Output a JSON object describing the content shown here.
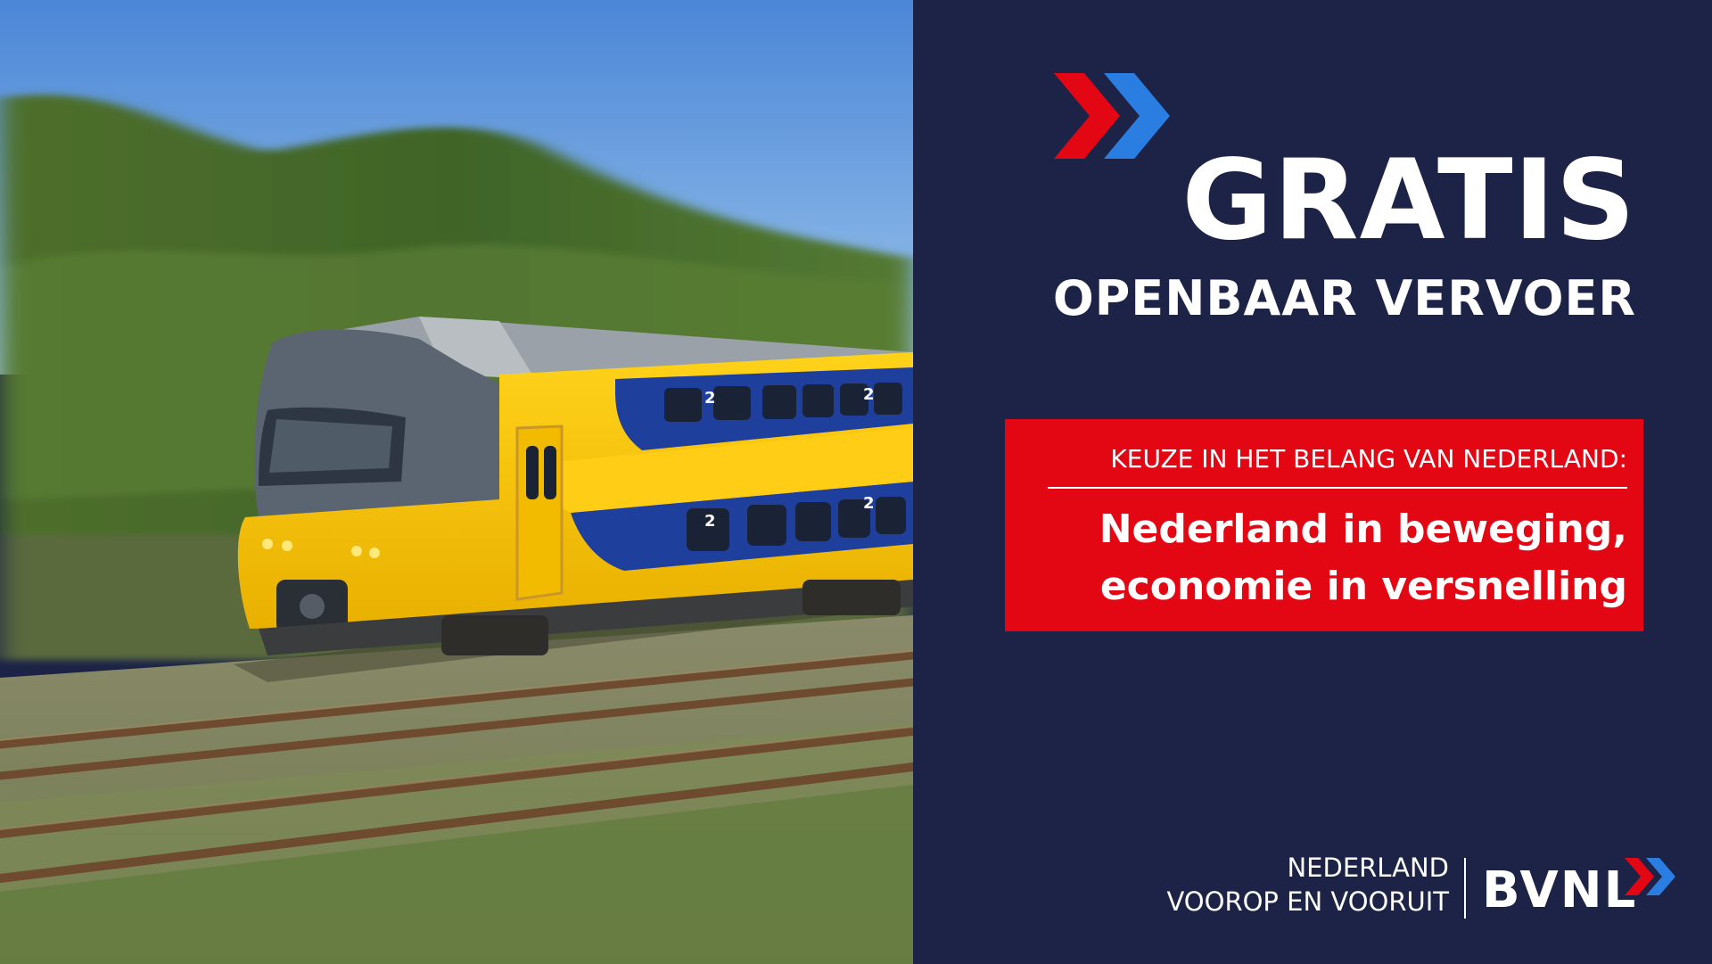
{
  "headline": "GRATIS",
  "subheadline": "OPENBAAR VERVOER",
  "callout": {
    "kicker": "KEUZE IN HET BELANG VAN NEDERLAND:",
    "claim_line1": "Nederland in beweging,",
    "claim_line2": "economie in versnelling"
  },
  "footer": {
    "tagline_line1": "NEDERLAND",
    "tagline_line2": "VOOROP EN VOORUIT",
    "logo_text": "BVNL"
  },
  "photo": {
    "car_number": "2"
  },
  "colors": {
    "navy": "#1c2347",
    "red": "#e30613",
    "blue": "#2a7de1",
    "train_yellow": "#f7c000",
    "train_blue": "#1f3f9c"
  }
}
